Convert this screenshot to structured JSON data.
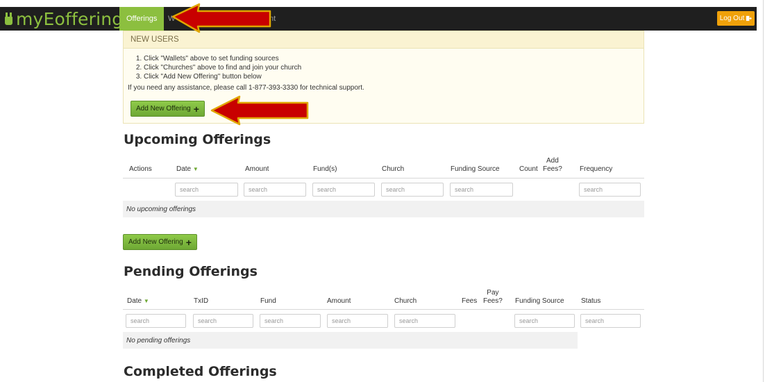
{
  "app": {
    "brand": "myEoffering"
  },
  "nav": {
    "offerings": "Offerings",
    "wallets_partial": "W",
    "account_partial": "nt",
    "logout": "Log Out"
  },
  "notice": {
    "title": "NEW USERS",
    "steps": [
      "Click \"Wallets\" above to set funding sources",
      "Click \"Churches\" above to find and join your church",
      "Click \"Add New Offering\" button below"
    ],
    "help": "If you need any assistance, please call 1-877-393-3330 for technical support.",
    "button": "Add New Offering"
  },
  "upcoming": {
    "title": "Upcoming Offerings",
    "headers": {
      "actions": "Actions",
      "date": "Date",
      "amount": "Amount",
      "funds": "Fund(s)",
      "church": "Church",
      "funding_source": "Funding Source",
      "count": "Count",
      "add_fees_1": "Add",
      "add_fees_2": "Fees?",
      "frequency": "Frequency"
    },
    "search_placeholder": "search",
    "empty": "No upcoming offerings",
    "button": "Add New Offering"
  },
  "pending": {
    "title": "Pending Offerings",
    "headers": {
      "date": "Date",
      "txid": "TxID",
      "fund": "Fund",
      "amount": "Amount",
      "church": "Church",
      "fees": "Fees",
      "pay_fees_1": "Pay",
      "pay_fees_2": "Fees?",
      "funding_source": "Funding Source",
      "status": "Status"
    },
    "search_placeholder": "search",
    "empty": "No pending offerings"
  },
  "completed": {
    "title": "Completed Offerings"
  },
  "colors": {
    "accent": "#8cbf3f",
    "topbar": "#1f1f1f",
    "logout": "#f0a10a",
    "arrow": "#c80000"
  },
  "icons": {
    "logo": "offering-box-icon",
    "logout": "door-exit-icon",
    "sort": "sort-down-icon",
    "plus": "plus-icon",
    "annotation": "red-arrow-icon"
  }
}
